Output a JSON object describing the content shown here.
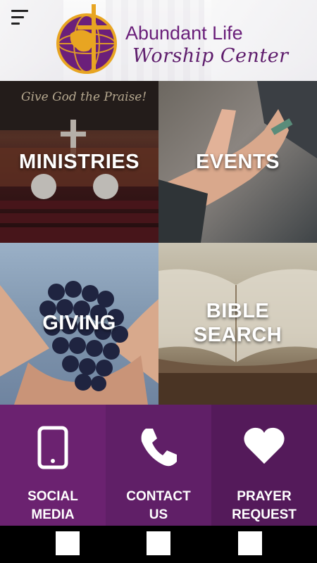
{
  "header": {
    "logo_line1": "Abundant Life",
    "logo_line2": "Worship Center"
  },
  "tiles": [
    {
      "label": "MINISTRIES"
    },
    {
      "label": "EVENTS"
    },
    {
      "label": "GIVING"
    },
    {
      "label_line1": "BIBLE",
      "label_line2": "SEARCH"
    }
  ],
  "actions": [
    {
      "line1": "SOCIAL",
      "line2": "MEDIA",
      "icon": "smartphone-icon"
    },
    {
      "line1": "CONTACT",
      "line2": "US",
      "icon": "phone-icon"
    },
    {
      "line1": "PRAYER",
      "line2": "REQUEST",
      "icon": "heart-icon"
    }
  ],
  "colors": {
    "brand_purple": "#6b2270",
    "logo_gold": "#e8a522"
  }
}
